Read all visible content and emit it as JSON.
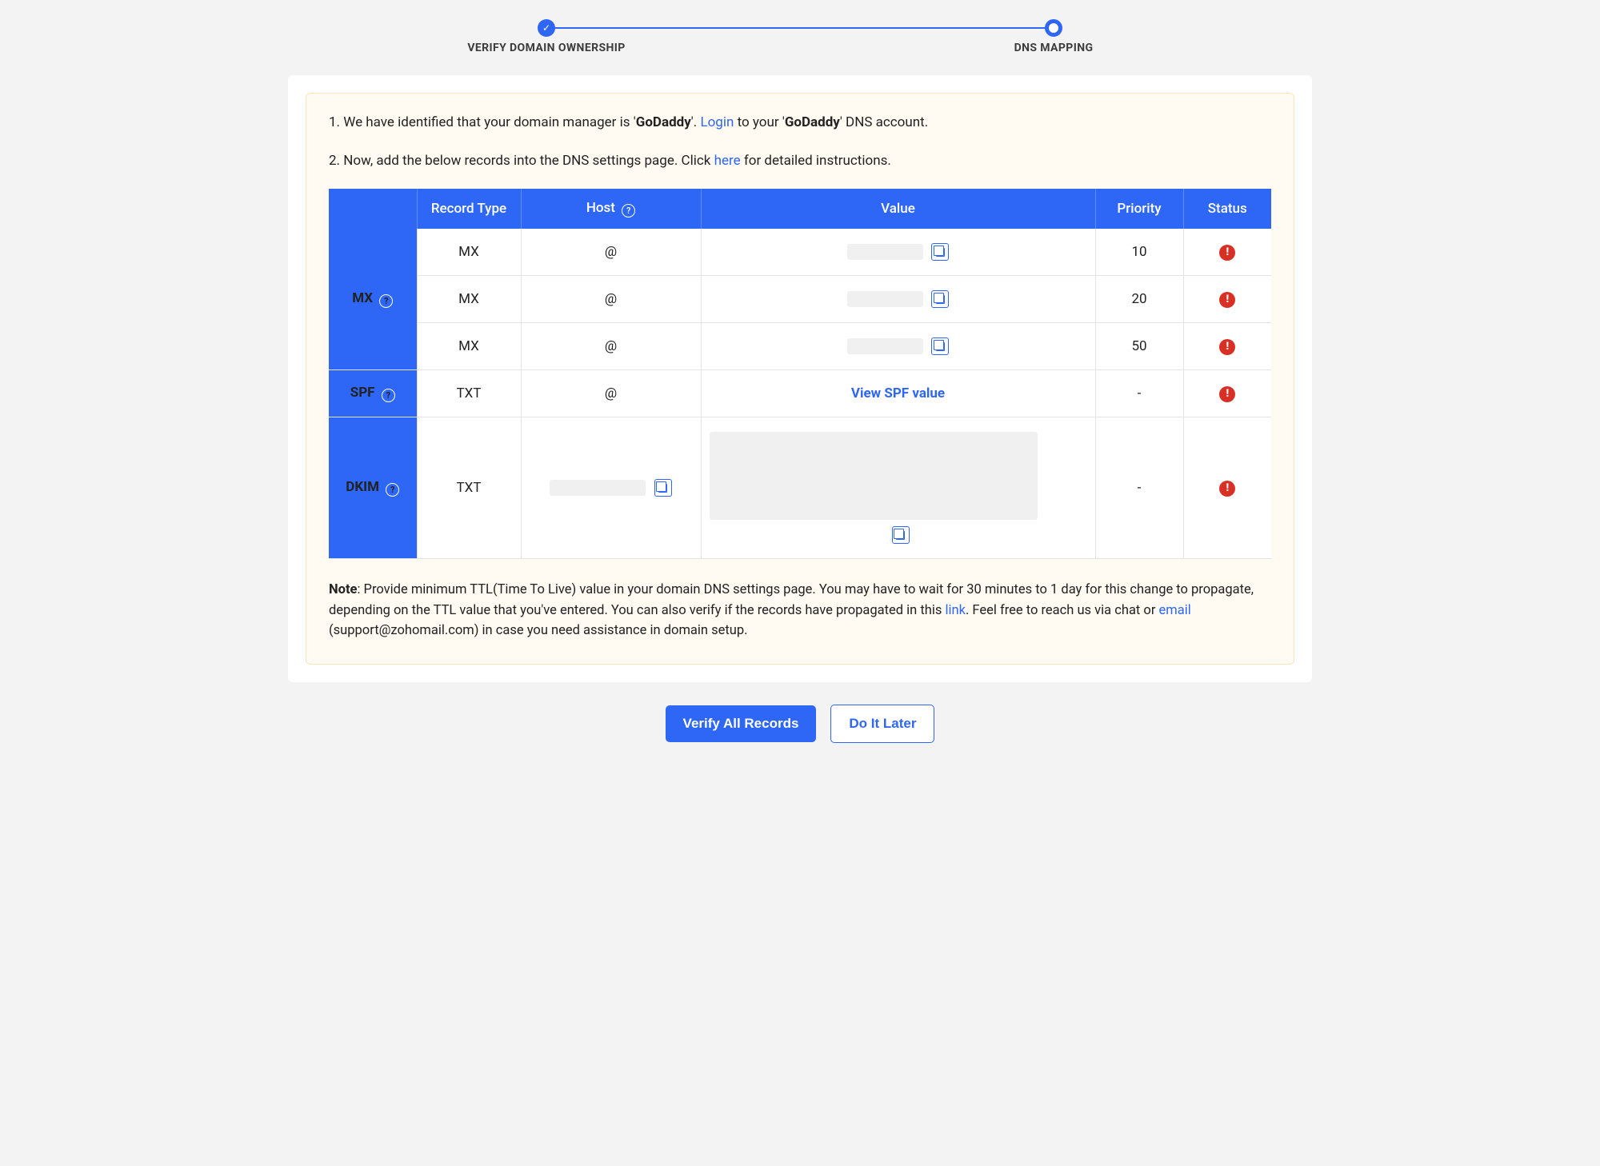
{
  "stepper": {
    "step1": "VERIFY DOMAIN OWNERSHIP",
    "step2": "DNS MAPPING"
  },
  "info": {
    "line1_a": "1. We have identified that your domain manager is '",
    "provider": "GoDaddy",
    "line1_b": "'. ",
    "login": "Login",
    "line1_c": " to your '",
    "line1_d": "' DNS account.",
    "line2_a": "2. Now, add the below records into the DNS settings page. Click ",
    "here": "here",
    "line2_b": " for detailed instructions."
  },
  "headers": {
    "record_type": "Record Type",
    "host": "Host",
    "value": "Value",
    "priority": "Priority",
    "status": "Status"
  },
  "groups": {
    "mx": "MX",
    "spf": "SPF",
    "dkim": "DKIM"
  },
  "rows": {
    "mx1": {
      "type": "MX",
      "host": "@",
      "priority": "10"
    },
    "mx2": {
      "type": "MX",
      "host": "@",
      "priority": "20"
    },
    "mx3": {
      "type": "MX",
      "host": "@",
      "priority": "50"
    },
    "spf": {
      "type": "TXT",
      "host": "@",
      "value_link": "View SPF value",
      "priority": "-"
    },
    "dkim": {
      "type": "TXT",
      "priority": "-"
    }
  },
  "note": {
    "label": "Note",
    "a": ": Provide minimum TTL(Time To Live) value in your domain DNS settings page. You may have to wait for 30 minutes to 1 day for this change to propagate, depending on the TTL value that you've entered. You can also verify if the records have propagated in this ",
    "link": "link",
    "b": ". Feel free to reach us via chat or ",
    "email": "email",
    "c": " (support@zohomail.com) in case you need assistance in domain setup."
  },
  "buttons": {
    "verify": "Verify All Records",
    "later": "Do It Later"
  }
}
